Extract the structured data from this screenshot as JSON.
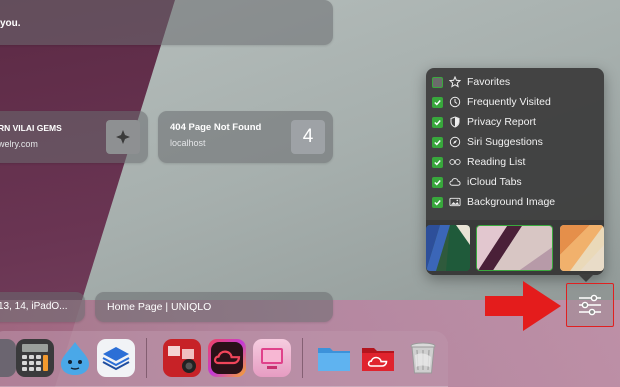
{
  "cards": {
    "top_partial": {
      "text": "you."
    },
    "gems": {
      "title": "RN VILAI GEMS",
      "subtitle": "welry.com"
    },
    "page404": {
      "title": "404 Page Not Found",
      "subtitle": "localhost",
      "thumb_number": "4"
    },
    "ipad": {
      "title": "13, 14, iPadO..."
    },
    "uniqlo": {
      "title": "Home Page | UNIQLO"
    }
  },
  "customize_menu": {
    "items": [
      {
        "label": "Favorites",
        "checked": false,
        "icon": "star-icon"
      },
      {
        "label": "Frequently Visited",
        "checked": true,
        "icon": "clock-icon"
      },
      {
        "label": "Privacy Report",
        "checked": true,
        "icon": "shield-icon"
      },
      {
        "label": "Siri Suggestions",
        "checked": true,
        "icon": "compass-icon"
      },
      {
        "label": "Reading List",
        "checked": true,
        "icon": "glasses-icon"
      },
      {
        "label": "iCloud Tabs",
        "checked": true,
        "icon": "cloud-icon"
      },
      {
        "label": "Background Image",
        "checked": true,
        "icon": "photo-icon"
      }
    ],
    "background_thumbnails": [
      "blue-green-abstract",
      "pink-purple-abstract",
      "orange-cream-abstract"
    ]
  },
  "settings_button": {
    "icon": "sliders-icon"
  },
  "dock": {
    "apps": [
      {
        "name": "app-partial",
        "icon": "app-icon"
      },
      {
        "name": "Calculator",
        "icon": "calculator-icon"
      },
      {
        "name": "Droplet",
        "icon": "droplet-icon"
      },
      {
        "name": "Layers",
        "icon": "layers-icon"
      },
      {
        "name": "Photo Booth",
        "icon": "photo-booth-icon"
      },
      {
        "name": "Creative Cloud",
        "icon": "creative-cloud-icon"
      },
      {
        "name": "CleanMyMac",
        "icon": "cleanmymac-icon"
      },
      {
        "name": "Downloads Folder",
        "icon": "folder-icon"
      },
      {
        "name": "Creative Cloud Folder",
        "icon": "cc-folder-icon"
      },
      {
        "name": "Trash",
        "icon": "trash-icon"
      }
    ]
  },
  "colors": {
    "checkbox_green": "#38a83c",
    "annotation_red": "#e02020"
  }
}
